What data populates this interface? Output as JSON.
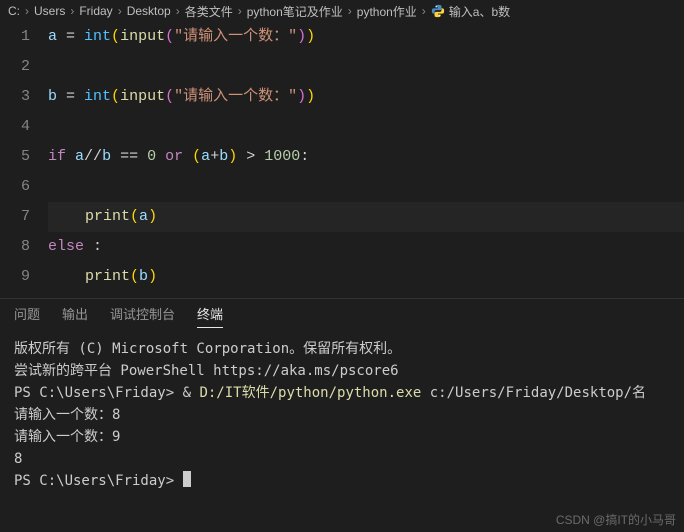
{
  "breadcrumb": {
    "items": [
      "C:",
      "Users",
      "Friday",
      "Desktop",
      "各类文件",
      "python笔记及作业",
      "python作业",
      "输入a、b数"
    ],
    "sep": "›"
  },
  "editor": {
    "lines": [
      {
        "num": "1",
        "tokens": [
          {
            "t": "a",
            "c": "tok-var"
          },
          {
            "t": " = ",
            "c": "tok-op"
          },
          {
            "t": "int",
            "c": "tok-fn"
          },
          {
            "t": "(",
            "c": "tok-yellow"
          },
          {
            "t": "input",
            "c": "tok-builtin"
          },
          {
            "t": "(",
            "c": "tok-pink"
          },
          {
            "t": "\"请输入一个数：\"",
            "c": "tok-str"
          },
          {
            "t": ")",
            "c": "tok-pink"
          },
          {
            "t": ")",
            "c": "tok-yellow"
          }
        ]
      },
      {
        "num": "2",
        "tokens": []
      },
      {
        "num": "3",
        "tokens": [
          {
            "t": "b",
            "c": "tok-var"
          },
          {
            "t": " = ",
            "c": "tok-op"
          },
          {
            "t": "int",
            "c": "tok-fn"
          },
          {
            "t": "(",
            "c": "tok-yellow"
          },
          {
            "t": "input",
            "c": "tok-builtin"
          },
          {
            "t": "(",
            "c": "tok-pink"
          },
          {
            "t": "\"请输入一个数：\"",
            "c": "tok-str"
          },
          {
            "t": ")",
            "c": "tok-pink"
          },
          {
            "t": ")",
            "c": "tok-yellow"
          }
        ]
      },
      {
        "num": "4",
        "tokens": []
      },
      {
        "num": "5",
        "tokens": [
          {
            "t": "if",
            "c": "tok-kw"
          },
          {
            "t": " ",
            "c": "tok-op"
          },
          {
            "t": "a",
            "c": "tok-var"
          },
          {
            "t": "//",
            "c": "tok-op"
          },
          {
            "t": "b",
            "c": "tok-var"
          },
          {
            "t": " == ",
            "c": "tok-op"
          },
          {
            "t": "0",
            "c": "tok-num"
          },
          {
            "t": " ",
            "c": "tok-op"
          },
          {
            "t": "or",
            "c": "tok-kw"
          },
          {
            "t": " ",
            "c": "tok-op"
          },
          {
            "t": "(",
            "c": "tok-yellow"
          },
          {
            "t": "a",
            "c": "tok-var"
          },
          {
            "t": "+",
            "c": "tok-op"
          },
          {
            "t": "b",
            "c": "tok-var"
          },
          {
            "t": ")",
            "c": "tok-yellow"
          },
          {
            "t": " > ",
            "c": "tok-op"
          },
          {
            "t": "1000",
            "c": "tok-num"
          },
          {
            "t": ":",
            "c": "tok-op"
          }
        ]
      },
      {
        "num": "6",
        "tokens": [
          {
            "t": "    ",
            "c": "tok-op",
            "guide": true
          }
        ]
      },
      {
        "num": "7",
        "tokens": [
          {
            "t": "    ",
            "c": "tok-op",
            "guide": true
          },
          {
            "t": "print",
            "c": "tok-builtin"
          },
          {
            "t": "(",
            "c": "tok-yellow"
          },
          {
            "t": "a",
            "c": "tok-var"
          },
          {
            "t": ")",
            "c": "tok-yellow"
          }
        ],
        "highlight": true
      },
      {
        "num": "8",
        "tokens": [
          {
            "t": "else",
            "c": "tok-kw"
          },
          {
            "t": " :",
            "c": "tok-op"
          }
        ]
      },
      {
        "num": "9",
        "tokens": [
          {
            "t": "    ",
            "c": "tok-op",
            "guide": true
          },
          {
            "t": "print",
            "c": "tok-builtin"
          },
          {
            "t": "(",
            "c": "tok-yellow"
          },
          {
            "t": "b",
            "c": "tok-var"
          },
          {
            "t": ")",
            "c": "tok-yellow"
          }
        ]
      }
    ]
  },
  "panel": {
    "tabs": [
      "问题",
      "输出",
      "调试控制台",
      "终端"
    ],
    "active_index": 3
  },
  "terminal": {
    "lines": [
      {
        "segs": [
          {
            "t": "版权所有 (C) Microsoft Corporation。保留所有权利。",
            "c": ""
          }
        ]
      },
      {
        "segs": [
          {
            "t": "",
            "c": ""
          }
        ]
      },
      {
        "segs": [
          {
            "t": "尝试新的跨平台 PowerShell https://aka.ms/pscore6",
            "c": ""
          }
        ]
      },
      {
        "segs": [
          {
            "t": "",
            "c": ""
          }
        ]
      },
      {
        "segs": [
          {
            "t": "PS C:\\Users\\Friday> & ",
            "c": ""
          },
          {
            "t": "D:/IT软件/python/python.exe",
            "c": "t-yellow"
          },
          {
            "t": " c:/Users/Friday/Desktop/名",
            "c": ""
          }
        ]
      },
      {
        "segs": [
          {
            "t": "请输入一个数：8",
            "c": ""
          }
        ]
      },
      {
        "segs": [
          {
            "t": "请输入一个数：9",
            "c": ""
          }
        ]
      },
      {
        "segs": [
          {
            "t": "8",
            "c": ""
          }
        ]
      },
      {
        "segs": [
          {
            "t": "PS C:\\Users\\Friday> ",
            "c": ""
          }
        ],
        "cursor": true
      }
    ]
  },
  "watermark": "CSDN @搞IT的小马哥"
}
